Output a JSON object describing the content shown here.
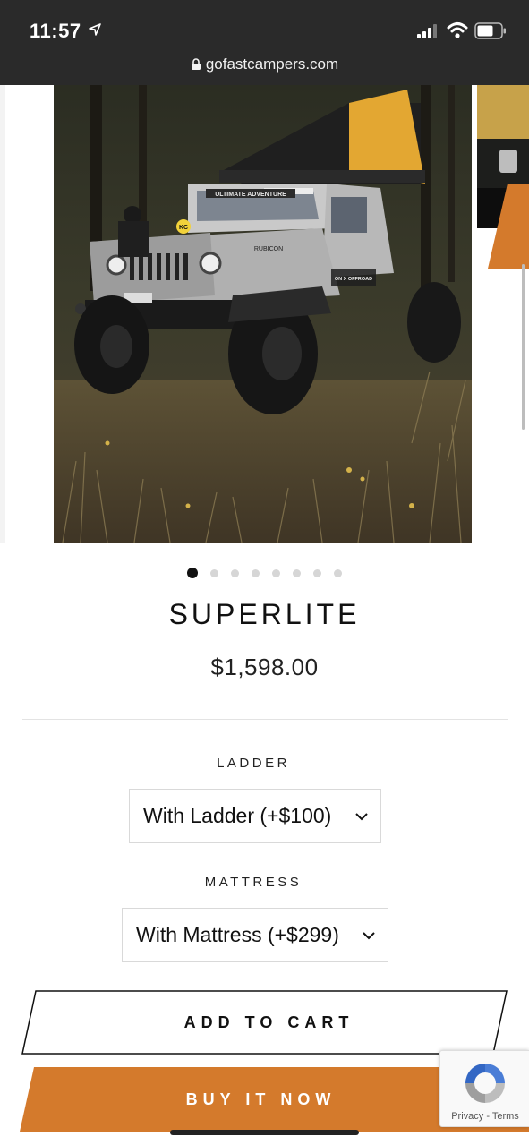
{
  "status_bar": {
    "time": "11:57",
    "url": "gofastcampers.com",
    "icons": [
      "location-arrow-icon",
      "signal-icon",
      "wifi-icon",
      "battery-icon",
      "lock-icon"
    ]
  },
  "gallery": {
    "slide_count": 8,
    "active_index": 0,
    "photo_labels": {
      "roof_banner": "ULTIMATE ADVENTURE",
      "hood_badge": "RUBICON",
      "door_decal": "ON X OFFROAD",
      "light_badge": "KC"
    }
  },
  "product": {
    "title": "SUPERLITE",
    "price": "$1,598.00"
  },
  "options": [
    {
      "label": "LADDER",
      "value": "With Ladder (+$100)"
    },
    {
      "label": "MATTRESS",
      "value": "With Mattress (+$299)"
    }
  ],
  "actions": {
    "add_to_cart": "ADD TO CART",
    "buy_now": "BUY IT NOW"
  },
  "recaptcha": {
    "privacy": "Privacy",
    "separator": " - ",
    "terms": "Terms"
  },
  "colors": {
    "status_bar": "#2a2a2a",
    "accent_orange": "#d47a2c",
    "tent_yellow": "#e3a732"
  }
}
